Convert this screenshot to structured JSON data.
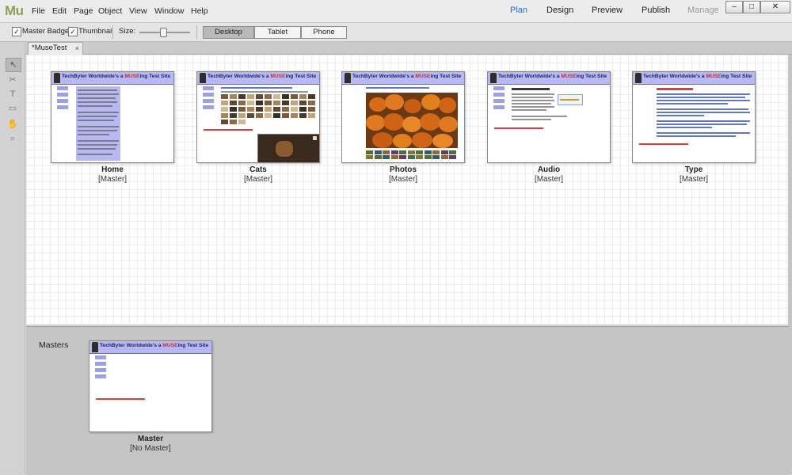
{
  "app": {
    "logo": "Mu",
    "menus": [
      "File",
      "Edit",
      "Page",
      "Object",
      "View",
      "Window",
      "Help"
    ],
    "modes": [
      "Plan",
      "Design",
      "Preview",
      "Publish",
      "Manage"
    ],
    "active_mode": "Plan",
    "window_controls": [
      "–",
      "□",
      "✕"
    ]
  },
  "toolbar": {
    "master_badge_label": "Master Badge",
    "master_badge_checked": true,
    "thumbnail_label": "Thumbnail",
    "thumbnail_checked": true,
    "size_label": "Size:",
    "size_value": 0.45,
    "devices": [
      "Desktop",
      "Tablet",
      "Phone"
    ],
    "active_device": "Desktop"
  },
  "tab": {
    "title": "*MuseTest",
    "close": "×"
  },
  "site_header": {
    "title_pre": "TechByter Worldwide's a ",
    "title_highlight": "MUSE",
    "title_post": "ing Test Site"
  },
  "pages": [
    {
      "name": "Home",
      "master": "[Master]"
    },
    {
      "name": "Cats",
      "master": "[Master]"
    },
    {
      "name": "Photos",
      "master": "[Master]"
    },
    {
      "name": "Audio",
      "master": "[Master]"
    },
    {
      "name": "Type",
      "master": "[Master]"
    }
  ],
  "masters_section": {
    "label": "Masters",
    "items": [
      {
        "name": "Master",
        "master": "[No Master]"
      }
    ]
  },
  "colors": {
    "accent": "#2a6ecf",
    "header_fill": "#b8b8f2",
    "highlight": "#d42a2a",
    "logo": "#8aa05a"
  }
}
